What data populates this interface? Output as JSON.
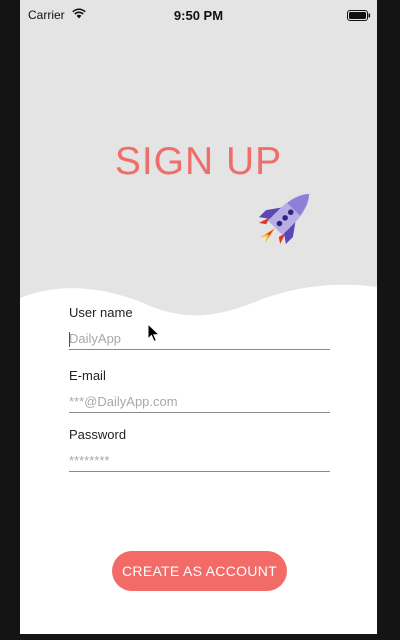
{
  "status_bar": {
    "carrier": "Carrier",
    "time": "9:50 PM",
    "wifi_icon": "wifi-icon",
    "battery_icon": "battery-icon"
  },
  "header": {
    "title": "SIGN UP",
    "icon": "rocket-icon"
  },
  "form": {
    "username": {
      "label": "User name",
      "placeholder": "DailyApp",
      "value": ""
    },
    "email": {
      "label": "E-mail",
      "placeholder": "***@DailyApp.com",
      "value": ""
    },
    "password": {
      "label": "Password",
      "placeholder": "********",
      "value": ""
    }
  },
  "actions": {
    "create_label": "CREATE AS ACCOUNT"
  },
  "colors": {
    "accent": "#f06e6a",
    "header_bg": "#e4e4e4",
    "bezel": "#141414"
  }
}
